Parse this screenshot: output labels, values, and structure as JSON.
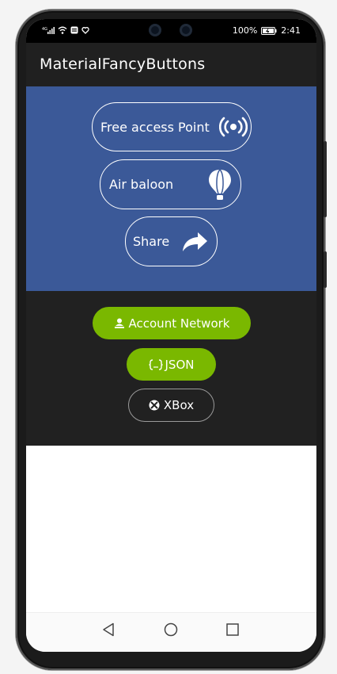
{
  "status": {
    "left_icons": [
      "signal-icon",
      "wifi-icon",
      "notification-icon",
      "message-icon"
    ],
    "battery": "100%",
    "time": "2:41"
  },
  "app": {
    "title": "MaterialFancyButtons"
  },
  "outline_buttons": [
    {
      "label": "Free access Point",
      "icon": "hotspot-icon"
    },
    {
      "label": "Air baloon",
      "icon": "balloon-icon"
    },
    {
      "label": "Share",
      "icon": "share-icon"
    }
  ],
  "pill_buttons": [
    {
      "label": "Account Network",
      "icon": "user-network-icon",
      "style": "filled"
    },
    {
      "label": "JSON",
      "icon": "braces-icon",
      "style": "filled"
    },
    {
      "label": "XBox",
      "icon": "xbox-icon",
      "style": "outline"
    }
  ],
  "navigation": [
    "back-icon",
    "home-icon",
    "recents-icon"
  ],
  "colors": {
    "blue_section": "#3b5998",
    "dark_section": "#212121",
    "app_bar": "#202020",
    "green_button": "#7ab800"
  }
}
